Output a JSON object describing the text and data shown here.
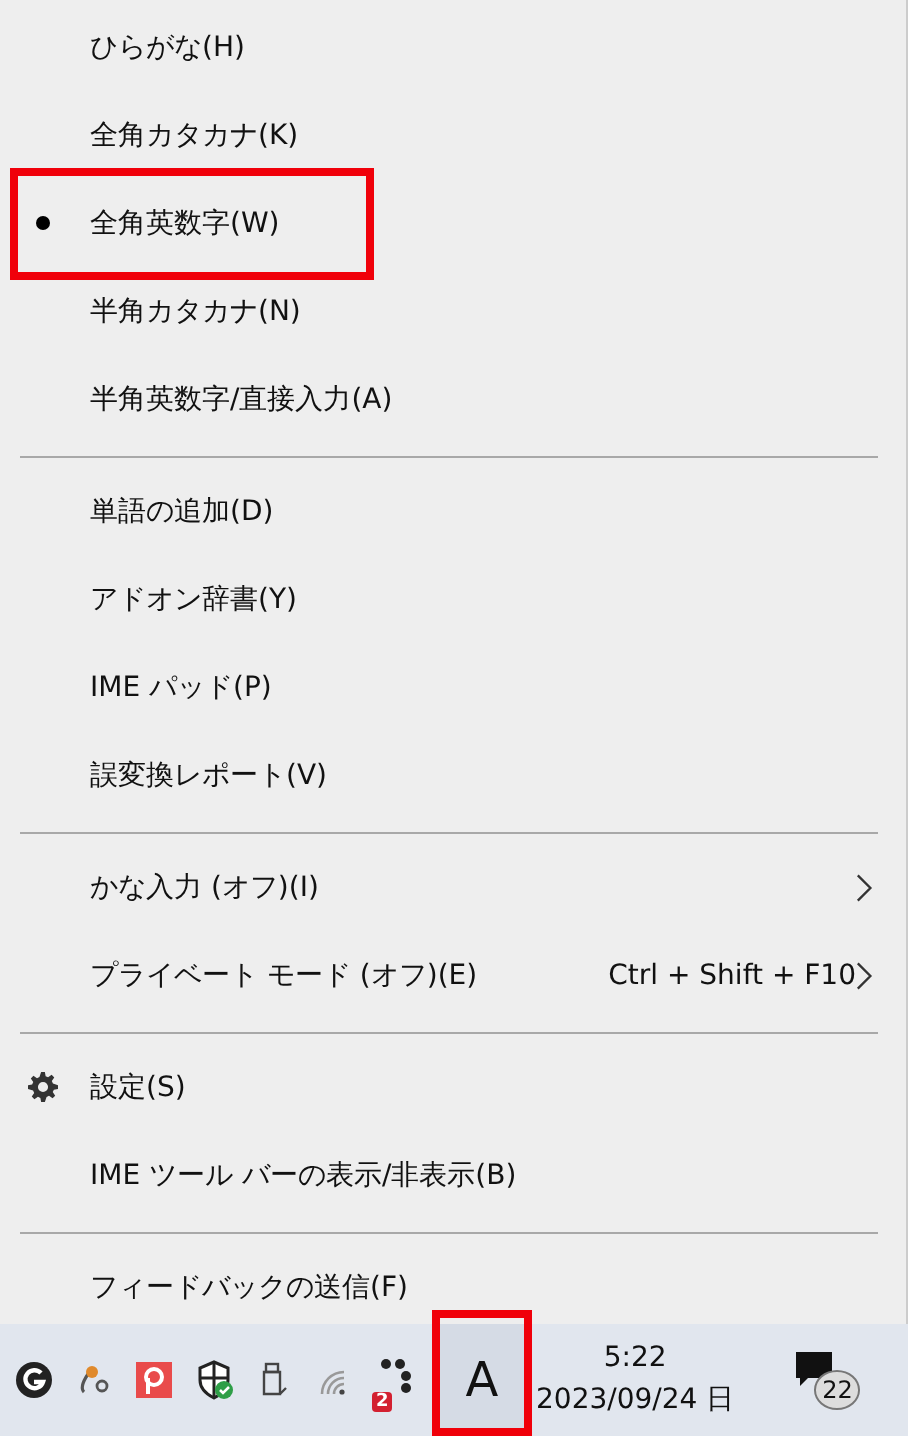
{
  "menu": {
    "groups": [
      {
        "items": [
          {
            "kind": "radio",
            "label": "ひらがな(H)",
            "selected": false,
            "highlighted": false
          },
          {
            "kind": "radio",
            "label": "全角カタカナ(K)",
            "selected": false,
            "highlighted": false
          },
          {
            "kind": "radio",
            "label": "全角英数字(W)",
            "selected": true,
            "highlighted": true
          },
          {
            "kind": "radio",
            "label": "半角カタカナ(N)",
            "selected": false,
            "highlighted": false
          },
          {
            "kind": "radio",
            "label": "半角英数字/直接入力(A)",
            "selected": false,
            "highlighted": false
          }
        ]
      },
      {
        "items": [
          {
            "kind": "plain",
            "label": "単語の追加(D)"
          },
          {
            "kind": "plain",
            "label": "アドオン辞書(Y)"
          },
          {
            "kind": "plain",
            "label": "IME パッド(P)"
          },
          {
            "kind": "plain",
            "label": "誤変換レポート(V)"
          }
        ]
      },
      {
        "items": [
          {
            "kind": "submenu",
            "label": "かな入力 (オフ)(I)"
          },
          {
            "kind": "submenu",
            "label": "プライベート モード (オフ)(E)",
            "shortcut": "Ctrl + Shift + F10"
          }
        ]
      },
      {
        "items": [
          {
            "kind": "setting",
            "label": "設定(S)"
          },
          {
            "kind": "plain",
            "label": "IME ツール バーの表示/非表示(B)"
          }
        ]
      },
      {
        "items": [
          {
            "kind": "plain",
            "label": "フィードバックの送信(F)"
          }
        ]
      }
    ]
  },
  "taskbar": {
    "badge": "2",
    "ime": {
      "label": "A",
      "highlighted": true
    },
    "time": "5:22",
    "date": "2023/09/24 日",
    "notifications": "22"
  }
}
